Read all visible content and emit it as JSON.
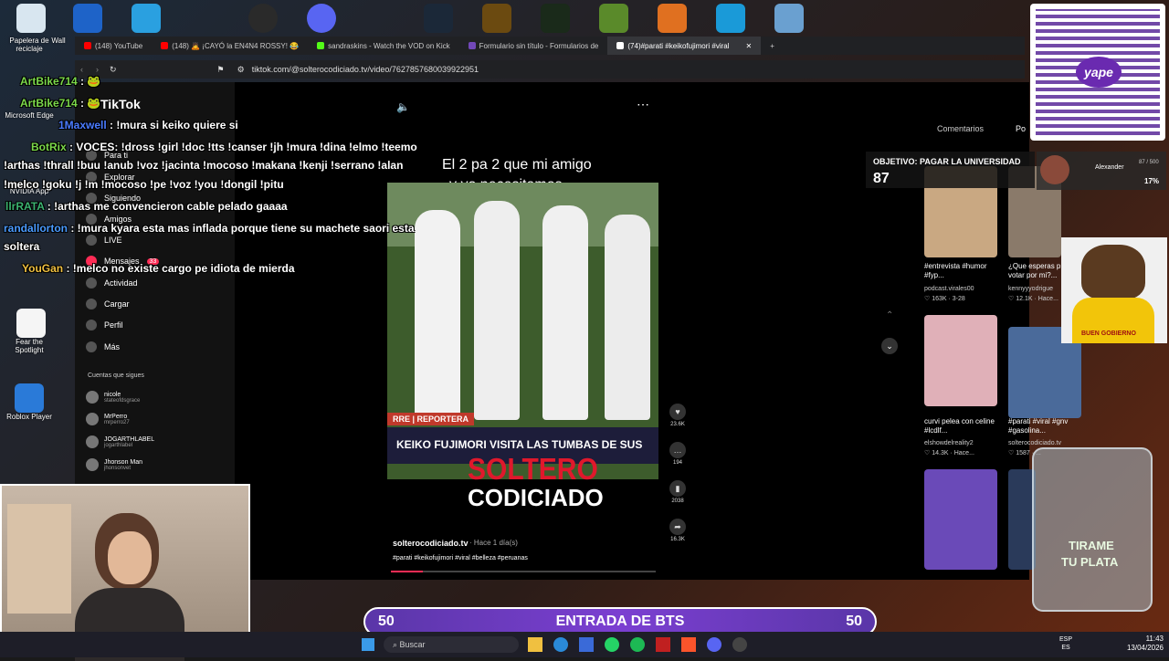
{
  "desktop": {
    "icons": [
      {
        "label": "Papelera de reciclaje"
      },
      {
        "label": "Wall"
      },
      {
        "label": "Microsoft Edge"
      },
      {
        "label": "NVIDIA App"
      },
      {
        "label": "Fear the Spotlight"
      },
      {
        "label": "Roblox Player"
      }
    ]
  },
  "browser": {
    "tabs": [
      {
        "label": "(148) YouTube",
        "color": "#ff0000"
      },
      {
        "label": "(148) 🙇 ¡CAYÓ la EN4N4 ROSSY! 😂",
        "color": "#ff0000"
      },
      {
        "label": "sandraskins - Watch the VOD on Kick",
        "color": "#53fc18"
      },
      {
        "label": "Formulario sin título - Formularios de",
        "color": "#7248b9"
      },
      {
        "label": "(74)#parati #keikofujimori #viral",
        "color": "#ffffff"
      }
    ],
    "url": "tiktok.com/@solterocodiciado.tv/video/7627857680039922951"
  },
  "tiktok": {
    "logo": "TikTok",
    "nav": [
      {
        "label": "Para ti",
        "icon": "home-icon"
      },
      {
        "label": "Explorar",
        "icon": "compass-icon"
      },
      {
        "label": "Siguiendo",
        "icon": "following-icon"
      },
      {
        "label": "Amigos",
        "icon": "friends-icon"
      },
      {
        "label": "LIVE",
        "icon": "live-icon"
      },
      {
        "label": "Mensajes",
        "icon": "message-icon"
      },
      {
        "label": "Actividad",
        "icon": "bell-icon"
      },
      {
        "label": "Cargar",
        "icon": "upload-icon"
      },
      {
        "label": "Perfil",
        "icon": "profile-icon"
      },
      {
        "label": "Más",
        "icon": "more-icon"
      }
    ],
    "messages_badge": "33",
    "following_title": "Cuentas que sigues",
    "following": [
      {
        "name": "nicole",
        "handle": "stateofdsgrace"
      },
      {
        "name": "MrPerro",
        "handle": "mrperro27"
      },
      {
        "name": "JOGARTHLABEL",
        "handle": "jogarthlabel"
      },
      {
        "name": "Jhonson Man",
        "handle": "jhonsonvet"
      }
    ],
    "video": {
      "caption_top_1": "El 2 pa 2 que mi amigo",
      "caption_top_2": "y yo necesitamos",
      "ticker_tag": "RRE | REPORTERA",
      "headline": "KEIKO FUJIMORI VISITA LAS TUMBAS DE SUS",
      "brand_1": "SOLTERO",
      "brand_2": "CODICIADO",
      "author": "solterocodiciado.tv",
      "time": "· Hace 1 día(s)",
      "hashtags": "#parati #keikofujimori #viral #belleza #peruanas",
      "likes": "23.6K",
      "comments": "194",
      "saves": "2038",
      "shares": "16.3K"
    },
    "tabs": {
      "comments": "Comentarios",
      "more": "Po"
    },
    "related": [
      {
        "caption": "#entrevista #humor #fyp...",
        "author": "podcast.virales00",
        "stats": "♡ 163K · 3-28"
      },
      {
        "caption": "¿Que esperas p votar por mi?...",
        "author": "kennyyyodrigue",
        "stats": "♡ 12.1K · Hace..."
      },
      {
        "caption": "curvi pelea con celine #lcdlf...",
        "author": "elshowdelreality2",
        "stats": "♡ 14.3K · Hace..."
      },
      {
        "caption": "#parati #viral #gnv #gasolina...",
        "author": "solterocodiciado.tv",
        "stats": "♡ 1587 · ..."
      }
    ]
  },
  "chat": [
    {
      "user": "ArtBike714",
      "text": " : 🐸",
      "color": "#7bd84a"
    },
    {
      "user": "ArtBike714",
      "text": " : 🐸",
      "color": "#7bd84a"
    },
    {
      "user": "1Maxwell",
      "text": " : !mura si keiko quiere si",
      "color": "#4a7bff"
    },
    {
      "user": "BotRix",
      "text": " : VOCES: !dross !girl !doc !tts !canser !jh !mura !dina !elmo !teemo",
      "color": "#7bd84a"
    },
    {
      "user": "",
      "text": "!arthas !thrall !buu !anub !voz !jacinta !mocoso !makana !kenji !serrano !alan",
      "color": "#ffffff"
    },
    {
      "user": "",
      "text": "!melco !goku !j !m !mocoso !pe !voz !you !dongil !pitu",
      "color": "#ffffff"
    },
    {
      "user": "llrRATA",
      "text": " : !arthas me convencieron cable pelado gaaaa",
      "color": "#3cb371"
    },
    {
      "user": "randallorton",
      "text": " : !mura kyara esta mas inflada porque tiene su machete saori esta",
      "color": "#4a9bff"
    },
    {
      "user": "",
      "text": "soltera",
      "color": "#ffffff"
    },
    {
      "user": "YouGan",
      "text": " : !melco no existe cargo pe idiota de mierda",
      "color": "#f0c040"
    }
  ],
  "overlay": {
    "goal_label": "OBJETIVO: PAGAR LA UNIVERSIDAD",
    "goal_value": "87",
    "donor": "Alexander",
    "donor_progress": "87 / 500",
    "donor_pct": "17%",
    "banner_left": "50",
    "banner_text": "ENTRADA DE BTS",
    "banner_right": "50",
    "dog_caption": "BUEN GOBIERNO",
    "jar_text_1": "TIRAME",
    "jar_text_2": "TU PLATA",
    "qr_brand": "yape"
  },
  "taskbar": {
    "search": "Buscar",
    "lang_1": "ESP",
    "lang_2": "ES",
    "time": "11:43",
    "date": "13/04/2026"
  }
}
